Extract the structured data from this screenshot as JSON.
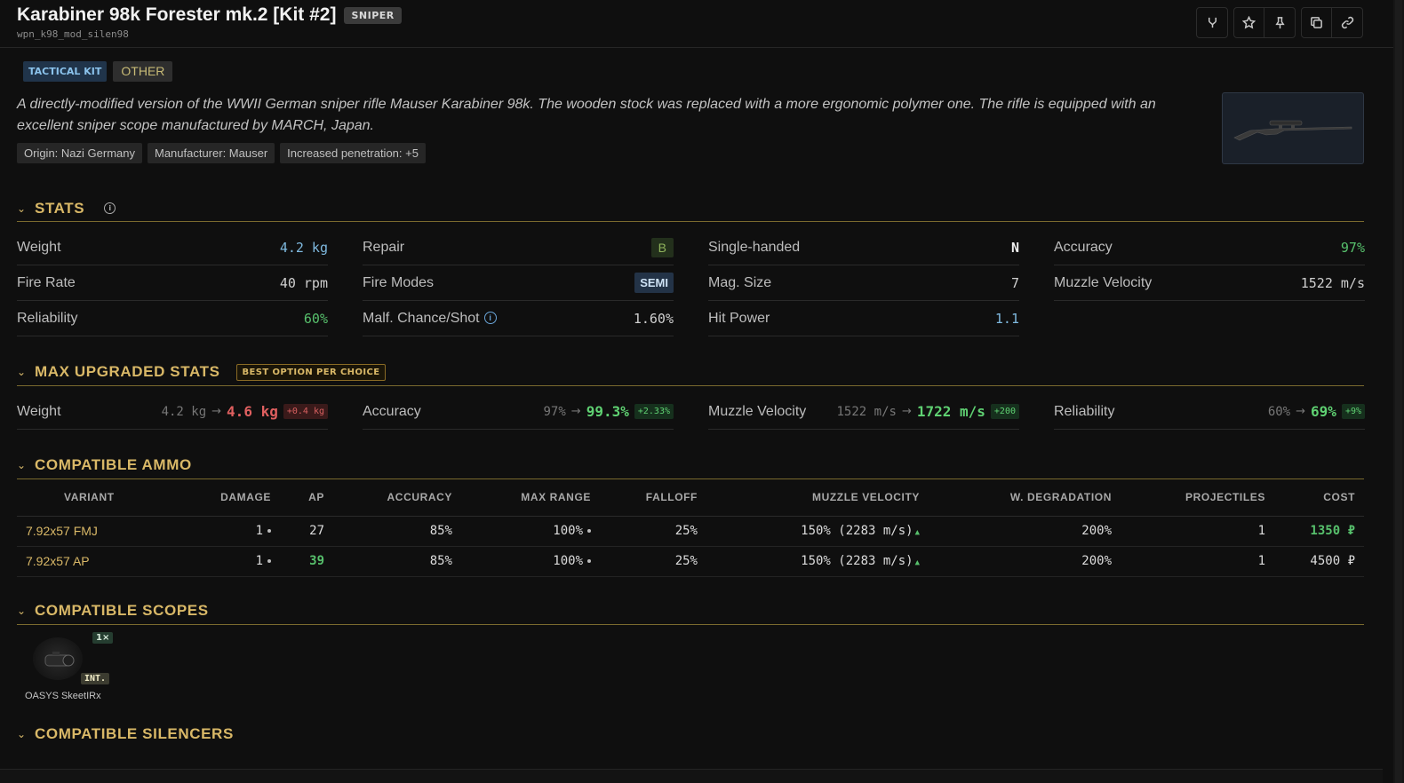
{
  "header": {
    "title": "Karabiner 98k Forester mk.2 [Kit #2]",
    "type_badge": "SNIPER",
    "item_id": "wpn_k98_mod_silen98",
    "buttons": [
      "fork-icon",
      "star-icon",
      "pin-icon",
      "copy-icon",
      "link-icon"
    ]
  },
  "info": {
    "tags": [
      "TACTICAL KIT",
      "OTHER"
    ],
    "description": "A directly-modified version of the WWII German sniper rifle Mauser Karabiner 98k. The wooden stock was replaced with a more ergonomic polymer one. The rifle is equipped with an excellent sniper scope manufactured by MARCH, Japan.",
    "chips": [
      "Origin: Nazi Germany",
      "Manufacturer: Mauser",
      "Increased penetration: +5"
    ]
  },
  "stats": {
    "title": "STATS",
    "weight": {
      "label": "Weight",
      "value": "4.2 kg"
    },
    "repair": {
      "label": "Repair",
      "value": "B"
    },
    "single_handed": {
      "label": "Single-handed",
      "value": "N"
    },
    "accuracy": {
      "label": "Accuracy",
      "value": "97%"
    },
    "fire_rate": {
      "label": "Fire Rate",
      "value": "40 rpm"
    },
    "fire_modes": {
      "label": "Fire Modes",
      "value": "SEMI"
    },
    "mag_size": {
      "label": "Mag. Size",
      "value": "7"
    },
    "muzzle_velocity": {
      "label": "Muzzle Velocity",
      "value": "1522 m/s"
    },
    "reliability": {
      "label": "Reliability",
      "value": "60%"
    },
    "malf_chance": {
      "label": "Malf. Chance/Shot",
      "value": "1.60%"
    },
    "hit_power": {
      "label": "Hit Power",
      "value": "1.1"
    }
  },
  "max_upgraded": {
    "title": "MAX UPGRADED STATS",
    "badge": "BEST OPTION PER CHOICE",
    "weight": {
      "label": "Weight",
      "old": "4.2 kg",
      "new": "4.6 kg",
      "delta": "+0.4 kg"
    },
    "accuracy": {
      "label": "Accuracy",
      "old": "97%",
      "new": "99.3%",
      "delta": "+2.33%"
    },
    "muzzle_velocity": {
      "label": "Muzzle Velocity",
      "old": "1522 m/s",
      "new": "1722 m/s",
      "delta": "+200"
    },
    "reliability": {
      "label": "Reliability",
      "old": "60%",
      "new": "69%",
      "delta": "+9%"
    }
  },
  "ammo": {
    "title": "COMPATIBLE AMMO",
    "columns": [
      "VARIANT",
      "DAMAGE",
      "AP",
      "ACCURACY",
      "MAX RANGE",
      "FALLOFF",
      "MUZZLE VELOCITY",
      "W. DEGRADATION",
      "PROJECTILES",
      "COST"
    ],
    "rows": [
      {
        "variant": "7.92x57 FMJ",
        "damage": "1",
        "ap": "27",
        "accuracy": "85%",
        "max_range": "100%",
        "falloff": "25%",
        "muzzle_velocity": "150% (2283 m/s)",
        "w_degradation": "200%",
        "projectiles": "1",
        "cost": "1350 ₽"
      },
      {
        "variant": "7.92x57 AP",
        "damage": "1",
        "ap": "39",
        "accuracy": "85%",
        "max_range": "100%",
        "falloff": "25%",
        "muzzle_velocity": "150% (2283 m/s)",
        "w_degradation": "200%",
        "projectiles": "1",
        "cost": "4500 ₽"
      }
    ]
  },
  "scopes": {
    "title": "COMPATIBLE SCOPES",
    "items": [
      {
        "name": "OASYS SkeetIRx",
        "count": "1×",
        "tag": "INT."
      }
    ]
  },
  "silencers": {
    "title": "COMPATIBLE SILENCERS"
  }
}
